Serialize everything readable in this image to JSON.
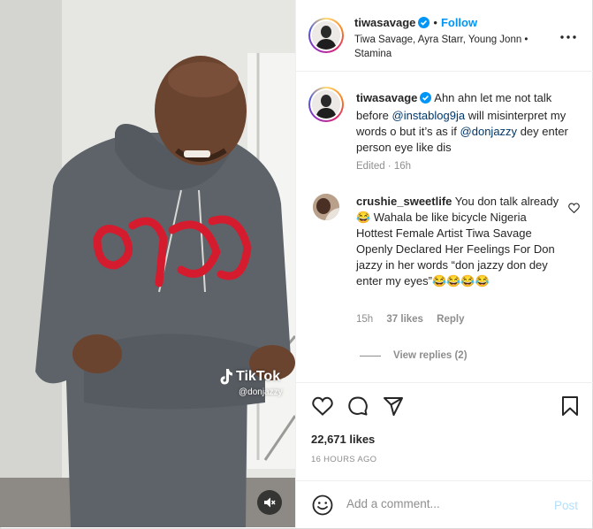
{
  "colors": {
    "accent": "#0095f6",
    "mention": "#00376b",
    "muted": "#8e8e8e",
    "post_disabled": "#b2dffc"
  },
  "media": {
    "watermark_brand": "TikTok",
    "watermark_handle": "@donjazzy",
    "mute_icon": "speaker-muted-icon"
  },
  "header": {
    "username": "tiwasavage",
    "separator": "•",
    "follow_label": "Follow",
    "audio_line": "Tiwa Savage, Ayra Starr, Young Jonn • Stamina",
    "more_icon": "more-options-icon"
  },
  "caption": {
    "username": "tiwasavage",
    "text_1": "Ahn ahn let me not talk before",
    "mention_1": "@instablog9ja",
    "text_2": "will misinterpret my words o but it’s as if",
    "mention_2": "@donjazzy",
    "text_3": "dey enter person eye like dis",
    "edited": "Edited · 16h"
  },
  "comment": {
    "username": "crushie_sweetlife",
    "text": "You don talk already😂 Wahala be like bicycle Nigeria Hottest Female Artist Tiwa Savage Openly Declared Her Feelings For Don jazzy in her words “don jazzy don dey enter my eyes”😂😂😂😂",
    "time": "15h",
    "likes": "37 likes",
    "reply": "Reply",
    "view_replies": "View replies (2)"
  },
  "actions": {
    "icons": [
      "heart-icon",
      "comment-icon",
      "share-icon",
      "bookmark-icon"
    ],
    "likes": "22,671 likes",
    "timestamp": "16 HOURS AGO"
  },
  "add_comment": {
    "placeholder": "Add a comment...",
    "post_label": "Post",
    "emoji_icon": "emoji-icon"
  }
}
